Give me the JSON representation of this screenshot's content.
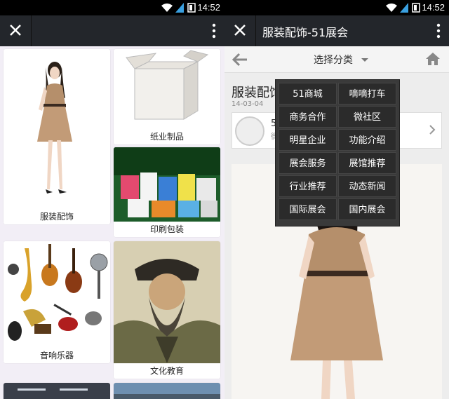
{
  "status": {
    "time": "14:52",
    "icons": [
      "wifi-icon",
      "signal-icon",
      "battery-icon"
    ]
  },
  "left": {
    "window": {
      "title": "",
      "icons": [
        "close-icon",
        "more-icon"
      ]
    },
    "categories": [
      {
        "label": "服装配饰"
      },
      {
        "label": "纸业制品"
      },
      {
        "label": "印刷包装"
      },
      {
        "label": "音响乐器"
      },
      {
        "label": "文化教育"
      }
    ]
  },
  "right": {
    "window": {
      "title": "服装配饰-51展会"
    },
    "nav": {
      "select_label": "选择分类"
    },
    "article": {
      "title": "服装配饰",
      "date": "14-03-04",
      "author_initial": "5",
      "author_sub": "微"
    },
    "menu": [
      "51商城",
      "嘀嘀打车",
      "商务合作",
      "微社区",
      "明星企业",
      "功能介绍",
      "展会服务",
      "展馆推荐",
      "行业推荐",
      "动态新闻",
      "国际展会",
      "国内展会"
    ]
  },
  "colors": {
    "titlebar": "#23262b",
    "menu_bg": "#3a3a3a"
  }
}
